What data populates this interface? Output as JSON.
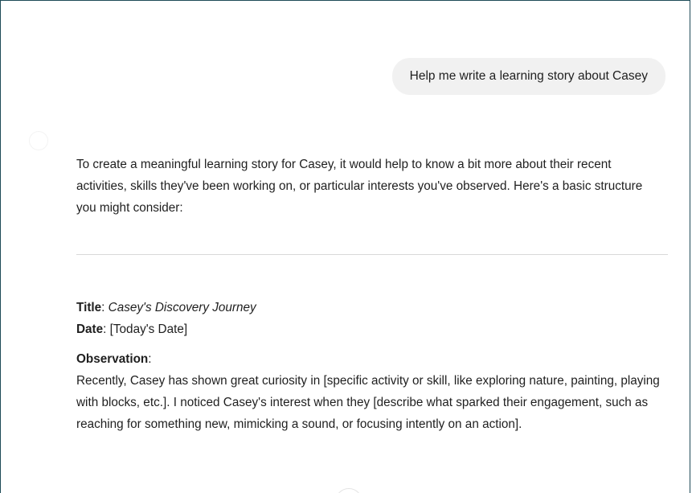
{
  "conversation": {
    "user_message": "Help me write a learning story about Casey",
    "assistant": {
      "intro": "To create a meaningful learning story for Casey, it would help to know a bit more about their recent activities, skills they've been working on, or particular interests you've observed. Here's a basic structure you might consider:",
      "title_label": "Title",
      "title_sep": ": ",
      "title_value": "Casey's Discovery Journey",
      "date_label": "Date",
      "date_sep": ": ",
      "date_value": "[Today's Date]",
      "observation_label": "Observation",
      "observation_sep": ":",
      "observation_body": "Recently, Casey has shown great curiosity in [specific activity or skill, like exploring nature, painting, playing with blocks, etc.]. I noticed Casey's interest when they [describe what sparked their engagement, such as reaching for something new, mimicking a sound, or focusing intently on an action]."
    }
  },
  "colors": {
    "frame_border": "#1e4b57",
    "user_bubble_bg": "#f1f1f1",
    "text": "#1f1f1f",
    "divider": "#d9d9d9"
  },
  "icons": {
    "assistant_avatar": "assistant-avatar-icon",
    "scroll_down": "scroll-down-button"
  }
}
